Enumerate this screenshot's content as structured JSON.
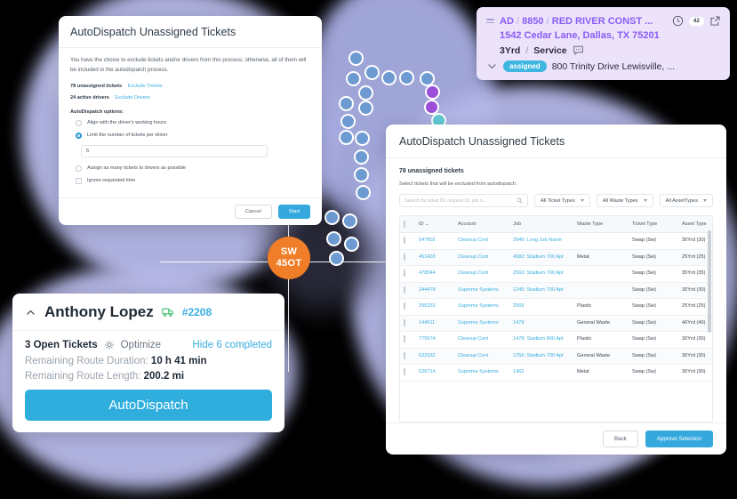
{
  "map": {
    "badge": {
      "line1": "SW",
      "line2": "45OT"
    },
    "marker_colors": {
      "blue": "#6d9ad1",
      "purple": "#9b4fd8",
      "teal": "#62c9d3"
    },
    "backdrop_color": "#b9bbe6"
  },
  "exclude_dialog": {
    "title": "AutoDispatch Unassigned Tickets",
    "paragraph": "You have the choice to exclude tickets and/or drivers from this process; otherwise, all of them will be included in the autodispatch process.",
    "tickets_count_label": "78 unassigned tickets",
    "exclude_tickets_link": "Exclude Tickets",
    "drivers_count_label": "24 active drivers",
    "exclude_drivers_link": "Exclude Drivers",
    "options_heading": "AutoDispatch options:",
    "options": [
      {
        "label": "Align with the driver's working hours",
        "selected": false
      },
      {
        "label": "Limit the number of tickets per driver",
        "selected": true
      },
      {
        "label": "Assign as many tickets to drivers as possible",
        "selected": false
      }
    ],
    "limit_value": "5",
    "checkbox_label": "Ignore requested time",
    "cancel_label": "Cancel",
    "start_label": "Start"
  },
  "tickets_dialog": {
    "title": "AutoDispatch Unassigned Tickets",
    "count_label": "78 unassigned tickets",
    "subtitle": "Select tickets that will be excluded from autodispatch.",
    "search_placeholder": "Search by ticket ID, request ID, job n...",
    "filters": [
      {
        "label": "All Ticket Types"
      },
      {
        "label": "All Waste Types"
      },
      {
        "label": "All AssetTypes"
      }
    ],
    "columns": [
      "ID",
      "Account",
      "Job",
      "Waste Type",
      "Ticket Type",
      "Asset Type"
    ],
    "rows": [
      {
        "id": "547802",
        "account": "Cleanup Cont",
        "job": "2940: Long Job Name",
        "waste": "",
        "ticket": "Swap (Sw)",
        "asset": "30Yrd (30)"
      },
      {
        "id": "451403",
        "account": "Cleanup Cont",
        "job": "4582: Stadium 700 Apt",
        "waste": "Metal",
        "ticket": "Swap (Sw)",
        "asset": "25Yrd (25)"
      },
      {
        "id": "478544",
        "account": "Cleanup Cont",
        "job": "2563: Stadium 700 Apt",
        "waste": "",
        "ticket": "Swap (Sw)",
        "asset": "35Yrd (35)"
      },
      {
        "id": "244478",
        "account": "Supreme Systems",
        "job": "1245: Stadium 700 Apt",
        "waste": "",
        "ticket": "Swap (Sw)",
        "asset": "30Yrd (30)"
      },
      {
        "id": "256333",
        "account": "Supreme Systems",
        "job": "2569",
        "waste": "Plastic",
        "ticket": "Swap (Sw)",
        "asset": "25Yrd (25)"
      },
      {
        "id": "144511",
        "account": "Supreme Systems",
        "job": "1478",
        "waste": "General Waste",
        "ticket": "Swap (Sw)",
        "asset": "40Yrd (40)"
      },
      {
        "id": "775574",
        "account": "Cleanup Cont",
        "job": "1478: Stadium 800 Apt",
        "waste": "Plastic",
        "ticket": "Swap (Sw)",
        "asset": "30Yrd (30)"
      },
      {
        "id": "533332",
        "account": "Cleanup Cont",
        "job": "1256: Stadium 700 Apt",
        "waste": "General Waste",
        "ticket": "Swap (Sw)",
        "asset": "30Yrd (30)"
      },
      {
        "id": "526714",
        "account": "Supreme Systems",
        "job": "1462",
        "waste": "Metal",
        "ticket": "Swap (Sw)",
        "asset": "30Yrd (30)"
      }
    ],
    "back_label": "Back",
    "approve_label": "Approve Selection"
  },
  "ticket_card": {
    "crumb_code": "AD",
    "crumb_number": "8850",
    "crumb_account": "RED RIVER CONST ...",
    "separator": "/",
    "count_badge": "42",
    "address": "1542 Cedar Lane, Dallas, TX 75201",
    "asset": "3Yrd",
    "service": "Service",
    "status": "assigned",
    "destination": "800 Trinity Drive Lewisville, ...",
    "accent": "#8b5cf6",
    "pill_color": "#3fb6e0"
  },
  "driver_card": {
    "name": "Anthony Lopez",
    "truck_id": "#2208",
    "open_tickets": "3 Open Tickets",
    "optimize_label": "Optimize",
    "hide_completed_label": "Hide 6 completed",
    "duration_label": "Remaining Route Duration:",
    "duration_value": "10 h 41 min",
    "length_label": "Remaining Route Length:",
    "length_value": "200.2 mi",
    "autodispatch_label": "AutoDispatch"
  }
}
